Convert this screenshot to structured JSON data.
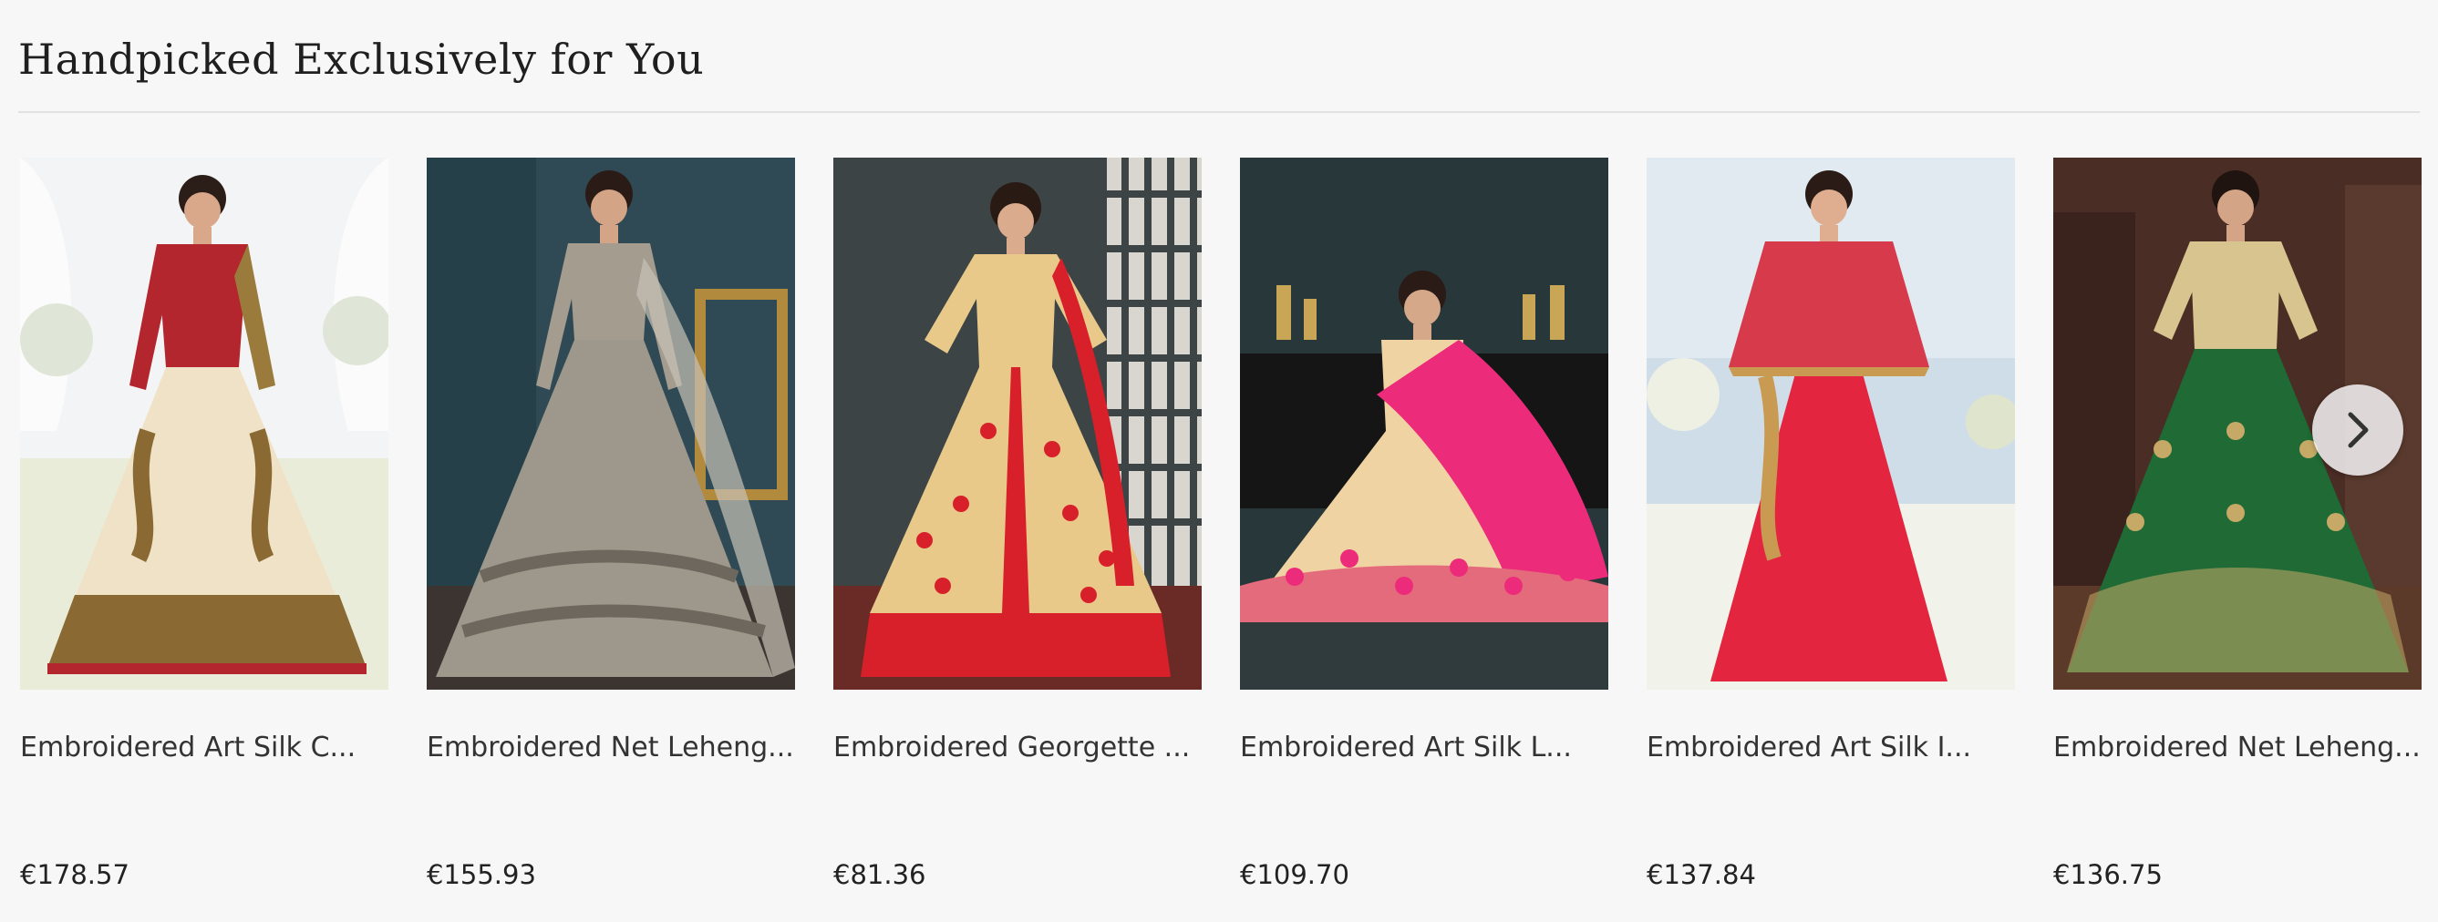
{
  "section": {
    "title": "Handpicked Exclusively for You"
  },
  "products": [
    {
      "name": "Embroidered Art Silk C...",
      "price": "€178.57",
      "colors": {
        "bg": "#e9ecef",
        "dress": "#efe2c6",
        "accent": "#b3262e",
        "trim": "#8a6a32"
      }
    },
    {
      "name": "Embroidered Net Leheng...",
      "price": "€155.93",
      "colors": {
        "bg": "#2f4a55",
        "dress": "#9e978c",
        "accent": "#c8c2b6",
        "trim": "#6d675d"
      }
    },
    {
      "name": "Embroidered Georgette ...",
      "price": "€81.36",
      "colors": {
        "bg": "#3c4446",
        "dress": "#e8c98a",
        "accent": "#d8202a",
        "trim": "#c7a05a"
      }
    },
    {
      "name": "Embroidered Art Silk L...",
      "price": "€109.70",
      "colors": {
        "bg": "#27373a",
        "dress": "#f0d3a3",
        "accent": "#ec2c7a",
        "trim": "#e0a83c"
      }
    },
    {
      "name": "Embroidered Art Silk I...",
      "price": "€137.84",
      "colors": {
        "bg": "#cfdde8",
        "dress": "#e3253f",
        "accent": "#d73a4a",
        "trim": "#c99a52"
      }
    },
    {
      "name": "Embroidered Net Leheng...",
      "price": "€136.75",
      "colors": {
        "bg": "#4a2d25",
        "dress": "#1f6a35",
        "accent": "#d8c48e",
        "trim": "#c6a966"
      }
    }
  ],
  "carousel": {
    "next_icon": "chevron-right-icon"
  }
}
